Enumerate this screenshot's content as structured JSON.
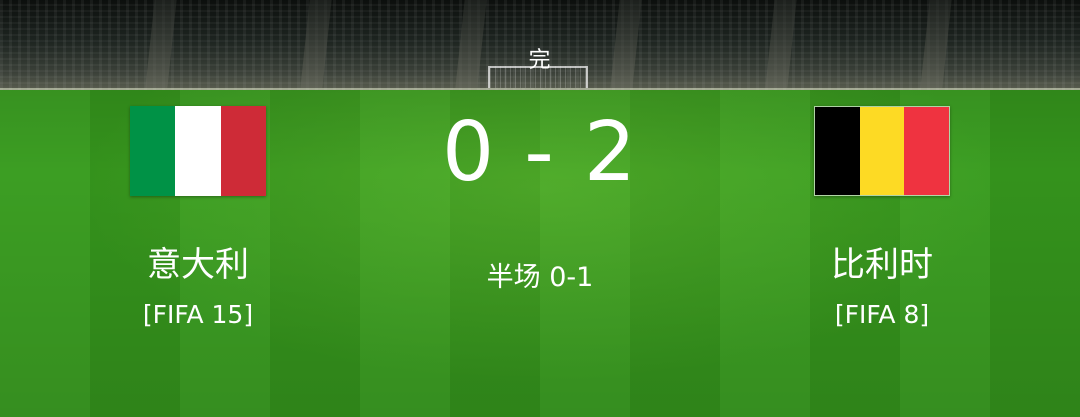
{
  "match": {
    "status": "完",
    "score": "0 - 2",
    "halftime": "半场 0-1"
  },
  "home": {
    "name": "意大利",
    "rank": "[FIFA 15]",
    "flag_colors": [
      "#009246",
      "#ffffff",
      "#ce2b37"
    ]
  },
  "away": {
    "name": "比利时",
    "rank": "[FIFA 8]",
    "flag_colors": [
      "#000000",
      "#fdda24",
      "#ef3340"
    ]
  },
  "colors": {
    "pitch": "#34921c",
    "text": "#ffffff"
  }
}
